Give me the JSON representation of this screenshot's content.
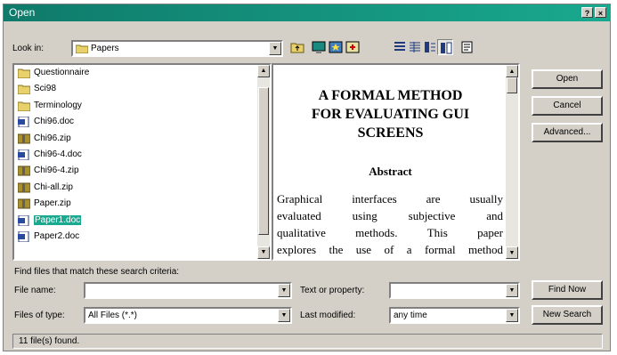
{
  "window": {
    "title": "Open",
    "help_glyph": "?",
    "close_glyph": "×"
  },
  "look_in": {
    "label": "Look in:",
    "value": "Papers"
  },
  "toolbar": [
    "up-folder-icon",
    "desktop-icon",
    "favorites-icon",
    "add-favorites-icon",
    "list-view-icon",
    "details-view-icon",
    "properties-view-icon",
    "preview-view-icon",
    "commands-icon"
  ],
  "files": [
    {
      "name": "Questionnaire",
      "icon": "folder-icon"
    },
    {
      "name": "Sci98",
      "icon": "folder-icon"
    },
    {
      "name": "Terminology",
      "icon": "folder-icon"
    },
    {
      "name": "Chi96.doc",
      "icon": "word-doc-icon"
    },
    {
      "name": "Chi96.zip",
      "icon": "zip-icon"
    },
    {
      "name": "Chi96-4.doc",
      "icon": "word-doc-icon"
    },
    {
      "name": "Chi96-4.zip",
      "icon": "zip-icon"
    },
    {
      "name": "Chi-all.zip",
      "icon": "zip-icon"
    },
    {
      "name": "Paper.zip",
      "icon": "zip-icon"
    },
    {
      "name": "Paper1.doc",
      "icon": "word-doc-icon"
    },
    {
      "name": "Paper2.doc",
      "icon": "word-doc-icon"
    }
  ],
  "preview": {
    "title_lines": [
      "A FORMAL METHOD",
      "FOR EVALUATING GUI",
      "SCREENS"
    ],
    "abstract_heading": "Abstract",
    "abstract_lines": [
      [
        "Graphical",
        "interfaces",
        "are",
        "usually"
      ],
      [
        "evaluated",
        "using",
        "subjective",
        "and"
      ],
      [
        "qualitative",
        "methods.",
        "This",
        "paper"
      ],
      [
        "explores",
        "the",
        "use",
        "of",
        "a",
        "formal",
        "method"
      ]
    ]
  },
  "buttons": {
    "open": "Open",
    "cancel": "Cancel",
    "advanced": "Advanced...",
    "find_now": "Find Now",
    "new_search": "New Search"
  },
  "search": {
    "heading": "Find files that match these search criteria:",
    "file_name_label": "File name:",
    "file_name_value": "",
    "files_of_type_label": "Files of type:",
    "files_of_type_value": "All Files (*.*)",
    "text_property_label": "Text or property:",
    "text_property_value": "",
    "last_modified_label": "Last modified:",
    "last_modified_value": "any time"
  },
  "status": "11 file(s) found."
}
